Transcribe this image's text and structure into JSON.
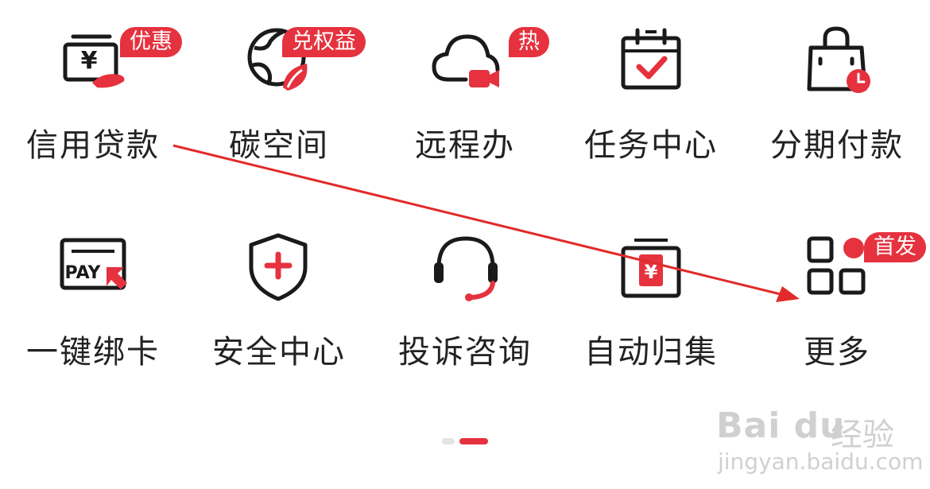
{
  "menu": {
    "row1": [
      {
        "label": "信用贷款",
        "badge": "优惠",
        "icon": "loan-yen-hand-icon"
      },
      {
        "label": "碳空间",
        "badge": "兑权益",
        "icon": "globe-leaf-icon"
      },
      {
        "label": "远程办",
        "badge": "热",
        "icon": "cloud-video-icon"
      },
      {
        "label": "任务中心",
        "badge": "",
        "icon": "calendar-check-icon"
      },
      {
        "label": "分期付款",
        "badge": "",
        "icon": "shopping-bag-clock-icon"
      }
    ],
    "row2": [
      {
        "label": "一键绑卡",
        "badge": "",
        "icon": "pay-card-icon"
      },
      {
        "label": "安全中心",
        "badge": "",
        "icon": "shield-plus-icon"
      },
      {
        "label": "投诉咨询",
        "badge": "",
        "icon": "headset-icon"
      },
      {
        "label": "自动归集",
        "badge": "",
        "icon": "yen-box-icon"
      },
      {
        "label": "更多",
        "badge": "首发",
        "icon": "grid-more-icon"
      }
    ]
  },
  "pager": {
    "pages": 2,
    "current": 2
  },
  "watermark": {
    "brand": "Bai du",
    "cn": "经验",
    "url": "jingyan.baidu.com"
  },
  "colors": {
    "accent": "#e5323e",
    "text": "#222222",
    "line": "#1a1a1a"
  }
}
